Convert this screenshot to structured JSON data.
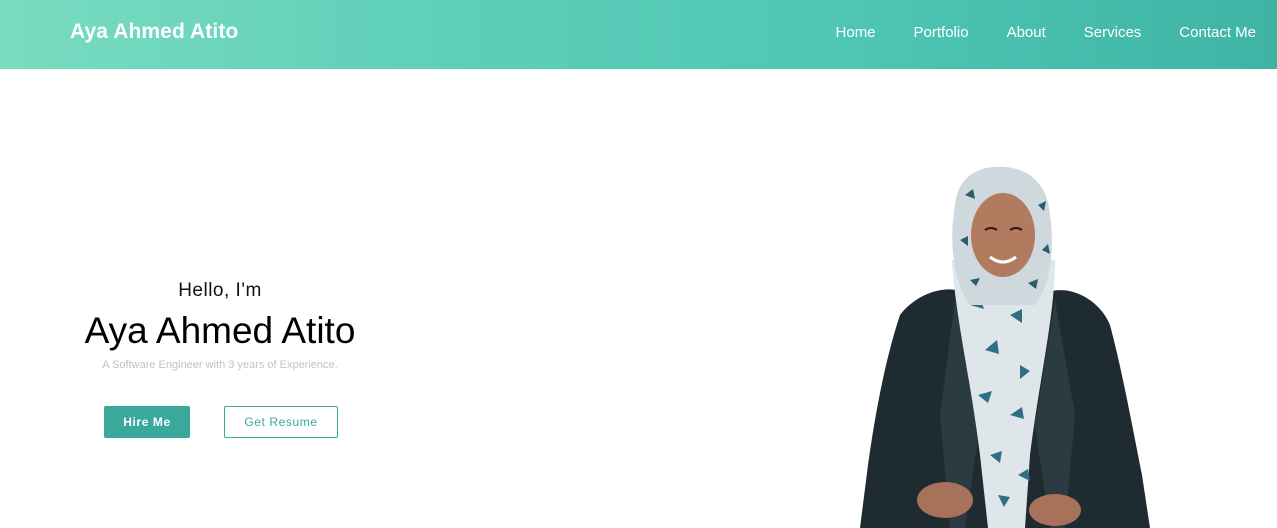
{
  "header": {
    "brand": "Aya Ahmed Atito",
    "nav": [
      "Home",
      "Portfolio",
      "About",
      "Services",
      "Contact Me"
    ]
  },
  "hero": {
    "greeting": "Hello, I'm",
    "name": "Aya Ahmed Atito",
    "tagline": "A Software Engineer with 3 years of Experience.",
    "primary_button": "Hire Me",
    "secondary_button": "Get Resume"
  },
  "colors": {
    "accent": "#38a99a",
    "nav_gradient_start": "#79dcc0",
    "nav_gradient_end": "#3fb4a5"
  },
  "icons": {
    "profile_photo": "profile-photo-portrait"
  }
}
